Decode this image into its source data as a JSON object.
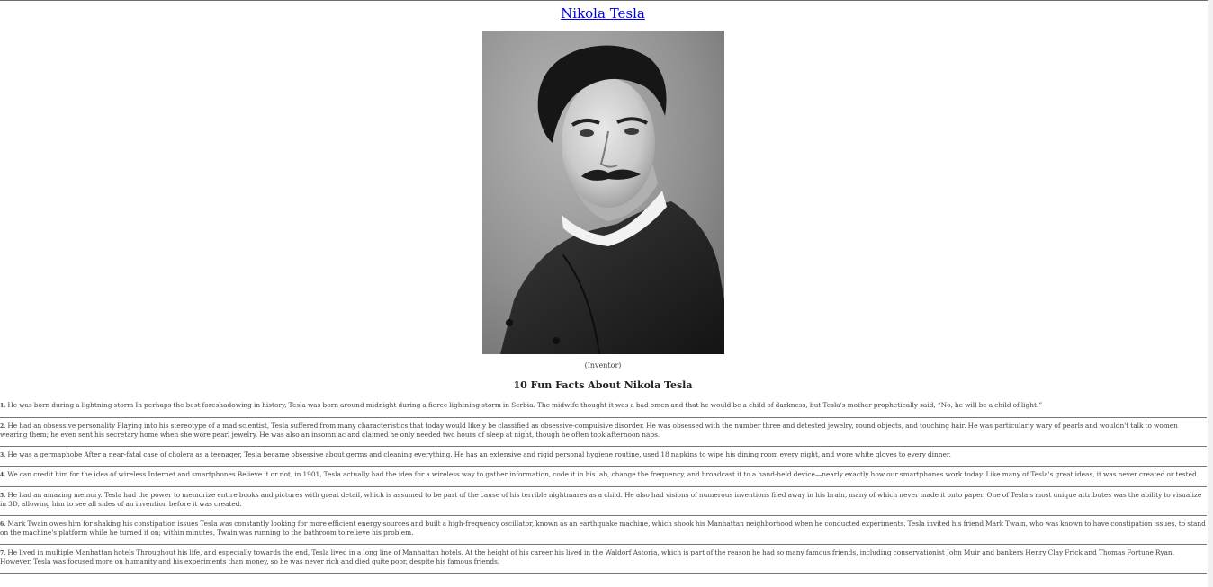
{
  "title": "Nikola Tesla",
  "image": {
    "alt": "Nikola Tesla portrait",
    "caption": "(Inventor)"
  },
  "section_heading": "10 Fun Facts About Nikola Tesla",
  "facts": [
    {
      "num": "1.",
      "text": "He was born during a lightning storm In perhaps the best foreshadowing in history, Tesla was born around midnight during a fierce lightning storm in Serbia. The midwife thought it was a bad omen and that he would be a child of darkness, but Tesla's mother prophetically said, “No, he will be a child of light.”"
    },
    {
      "num": "2.",
      "text": "He had an obsessive personality Playing into his stereotype of a mad scientist, Tesla suffered from many characteristics that today would likely be classified as obsessive-compulsive disorder. He was obsessed with the number three and detested jewelry, round objects, and touching hair. He was particularly wary of pearls and wouldn't talk to women wearing them; he even sent his secretary home when she wore pearl jewelry. He was also an insomniac and claimed he only needed two hours of sleep at night, though he often took afternoon naps."
    },
    {
      "num": "3.",
      "text": "He was a germaphobe After a near-fatal case of cholera as a teenager, Tesla became obsessive about germs and cleaning everything. He has an extensive and rigid personal hygiene routine, used 18 napkins to wipe his dining room every night, and wore white gloves to every dinner."
    },
    {
      "num": "4.",
      "text": "We can credit him for the idea of wireless Internet and smartphones Believe it or not, in 1901, Tesla actually had the idea for a wireless way to gather information, code it in his lab, change the frequency, and broadcast it to a hand-held device—nearly exactly how our smartphones work today. Like many of Tesla's great ideas, it was never created or tested."
    },
    {
      "num": "5.",
      "text": "He had an amazing memory. Tesla had the power to memorize entire books and pictures with great detail, which is assumed to be part of the cause of his terrible nightmares as a child. He also had visions of numerous inventions filed away in his brain, many of which never made it onto paper. One of Tesla's most unique attributes was the ability to visualize in 3D, allowing him to see all sides of an invention before it was created."
    },
    {
      "num": "6.",
      "text": "Mark Twain owes him for shaking his constipation issues Tesla was constantly looking for more efficient energy sources and built a high-frequency oscillator, known as an earthquake machine, which shook his Manhattan neighborhood when he conducted experiments. Tesla invited his friend Mark Twain, who was known to have constipation issues, to stand on the machine's platform while he turned it on; within minutes, Twain was running to the bathroom to relieve his problem."
    },
    {
      "num": "7.",
      "text": "He lived in multiple Manhattan hotels Throughout his life, and especially towards the end, Tesla lived in a long line of Manhattan hotels. At the height of his career his lived in the Waldorf Astoria, which is part of the reason he had so many famous friends, including conservationist John Muir and bankers Henry Clay Frick and Thomas Fortune Ryan. However, Tesla was focused more on humanity and his experiments than money, so he was never rich and died quite poor, despite his famous friends."
    }
  ]
}
